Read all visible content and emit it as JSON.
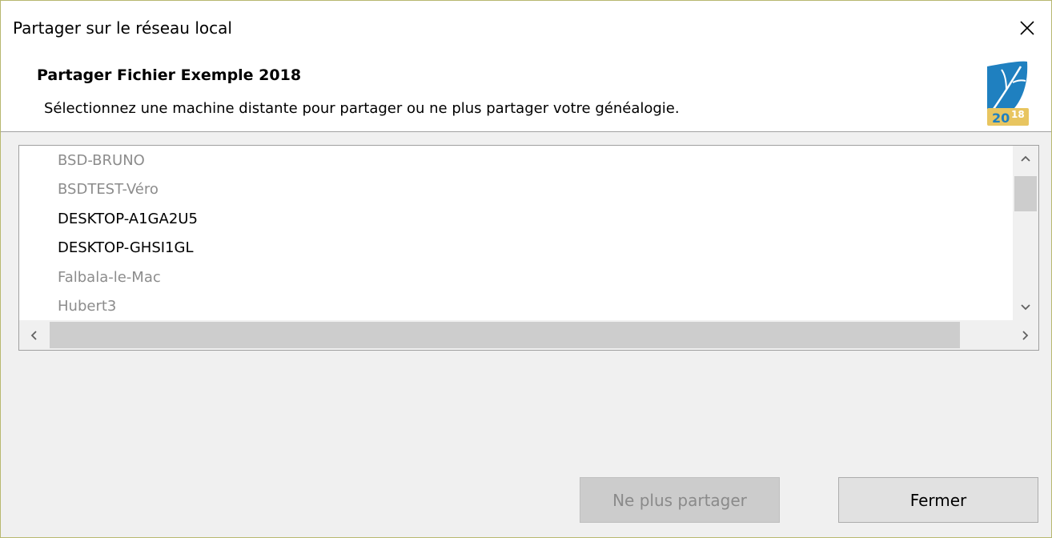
{
  "window": {
    "title": "Partager sur le réseau local"
  },
  "header": {
    "title": "Partager Fichier Exemple 2018",
    "subtitle": "Sélectionnez une machine distante pour partager ou ne plus partager votre généalogie.",
    "logo_text": "2018"
  },
  "machines": [
    {
      "label": "BSD-BRUNO",
      "enabled": false
    },
    {
      "label": "BSDTEST-Véro",
      "enabled": false
    },
    {
      "label": "DESKTOP-A1GA2U5",
      "enabled": true
    },
    {
      "label": "DESKTOP-GHSI1GL",
      "enabled": true
    },
    {
      "label": "Falbala-le-Mac",
      "enabled": false
    },
    {
      "label": "Hubert3",
      "enabled": false
    }
  ],
  "buttons": {
    "unshare_label": "Ne plus partager",
    "close_label": "Fermer"
  },
  "colors": {
    "enabled_text": "#000000",
    "disabled_text": "#8c8c8c",
    "logo_blue": "#1f80c0",
    "logo_gold": "#e8c560"
  }
}
